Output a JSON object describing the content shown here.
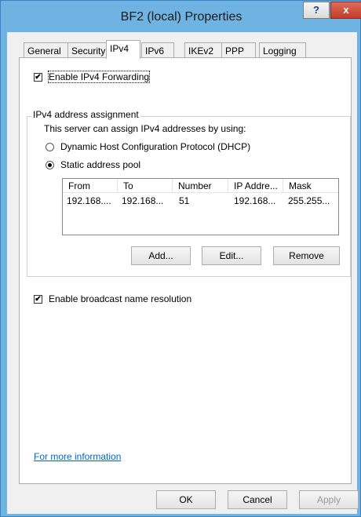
{
  "window": {
    "title": "BF2 (local) Properties",
    "help_label": "?",
    "close_label": "x"
  },
  "tabs": [
    {
      "label": "General"
    },
    {
      "label": "Security"
    },
    {
      "label": "IPv4"
    },
    {
      "label": "IPv6"
    },
    {
      "label": "IKEv2"
    },
    {
      "label": "PPP"
    },
    {
      "label": "Logging"
    }
  ],
  "active_tab": "IPv4",
  "ipv4": {
    "enable_forwarding": {
      "label": "Enable IPv4 Forwarding",
      "checked": true
    },
    "assignment": {
      "group_title": "IPv4 address assignment",
      "description": "This server can assign IPv4 addresses by using:",
      "dhcp_label": "Dynamic Host Configuration Protocol (DHCP)",
      "static_label": "Static address pool",
      "selected": "static"
    },
    "pool_table": {
      "columns": [
        "From",
        "To",
        "Number",
        "IP Addre...",
        "Mask"
      ],
      "rows": [
        [
          "192.168....",
          "192.168...",
          "51",
          "192.168...",
          "255.255..."
        ]
      ]
    },
    "buttons": {
      "add": "Add...",
      "edit": "Edit...",
      "remove": "Remove"
    },
    "enable_broadcast": {
      "label": "Enable broadcast name resolution",
      "checked": true
    },
    "more_info_link": "For more information"
  },
  "footer": {
    "ok": "OK",
    "cancel": "Cancel",
    "apply": "Apply"
  },
  "colors": {
    "frame": "#6fb3e3",
    "close_button": "#c13d2a",
    "link": "#0066cc"
  }
}
